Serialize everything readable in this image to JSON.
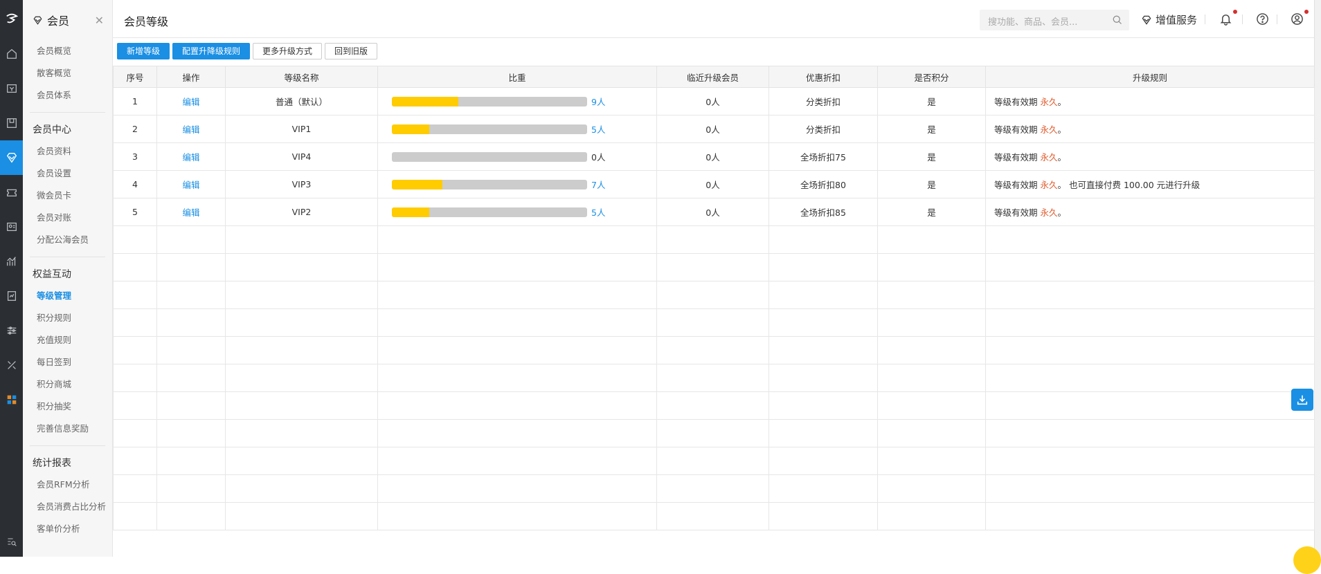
{
  "sidebar": {
    "title": "会员",
    "groups": [
      {
        "items": [
          "会员概览",
          "散客概览",
          "会员体系"
        ]
      },
      {
        "title": "会员中心",
        "items": [
          "会员资料",
          "会员设置",
          "微会员卡",
          "会员对账",
          "分配公海会员"
        ]
      },
      {
        "title": "权益互动",
        "items": [
          "等级管理",
          "积分规则",
          "充值规则",
          "每日签到",
          "积分商城",
          "积分抽奖",
          "完善信息奖励"
        ]
      },
      {
        "title": "统计报表",
        "items": [
          "会员RFM分析",
          "会员消费占比分析",
          "客单价分析"
        ]
      }
    ],
    "active_item": "等级管理"
  },
  "header": {
    "page_title": "会员等级",
    "search_placeholder": "搜功能、商品、会员...",
    "value_service": "增值服务"
  },
  "toolbar": {
    "add_level": "新增等级",
    "config_rules": "配置升降级规则",
    "more_methods": "更多升级方式",
    "back_old": "回到旧版"
  },
  "table": {
    "columns": [
      "序号",
      "操作",
      "等级名称",
      "比重",
      "临近升级会员",
      "优惠折扣",
      "是否积分",
      "升级规则"
    ],
    "rows": [
      {
        "no": "1",
        "action": "编辑",
        "name": "普通（默认）",
        "ratio": 0.34,
        "count": "9人",
        "near": "0人",
        "discount": "分类折扣",
        "points": "是",
        "rule_prefix": "等级有效期",
        "rule_value": "永久",
        "rule_suffix": "。"
      },
      {
        "no": "2",
        "action": "编辑",
        "name": "VIP1",
        "ratio": 0.19,
        "count": "5人",
        "near": "0人",
        "discount": "分类折扣",
        "points": "是",
        "rule_prefix": "等级有效期",
        "rule_value": "永久",
        "rule_suffix": "。"
      },
      {
        "no": "3",
        "action": "编辑",
        "name": "VIP4",
        "ratio": 0.0,
        "count": "0人",
        "near": "0人",
        "discount": "全场折扣75",
        "points": "是",
        "rule_prefix": "等级有效期",
        "rule_value": "永久",
        "rule_suffix": "。"
      },
      {
        "no": "4",
        "action": "编辑",
        "name": "VIP3",
        "ratio": 0.26,
        "count": "7人",
        "near": "0人",
        "discount": "全场折扣80",
        "points": "是",
        "rule_prefix": "等级有效期",
        "rule_value": "永久",
        "rule_suffix": "。  也可直接付费 100.00 元进行升级"
      },
      {
        "no": "5",
        "action": "编辑",
        "name": "VIP2",
        "ratio": 0.19,
        "count": "5人",
        "near": "0人",
        "discount": "全场折扣85",
        "points": "是",
        "rule_prefix": "等级有效期",
        "rule_value": "永久",
        "rule_suffix": "。"
      }
    ]
  },
  "colors": {
    "accent": "#1a8fe3",
    "bar_fill": "#ffcc00",
    "bar_track": "#cccccc",
    "highlight": "#e05a2b"
  }
}
